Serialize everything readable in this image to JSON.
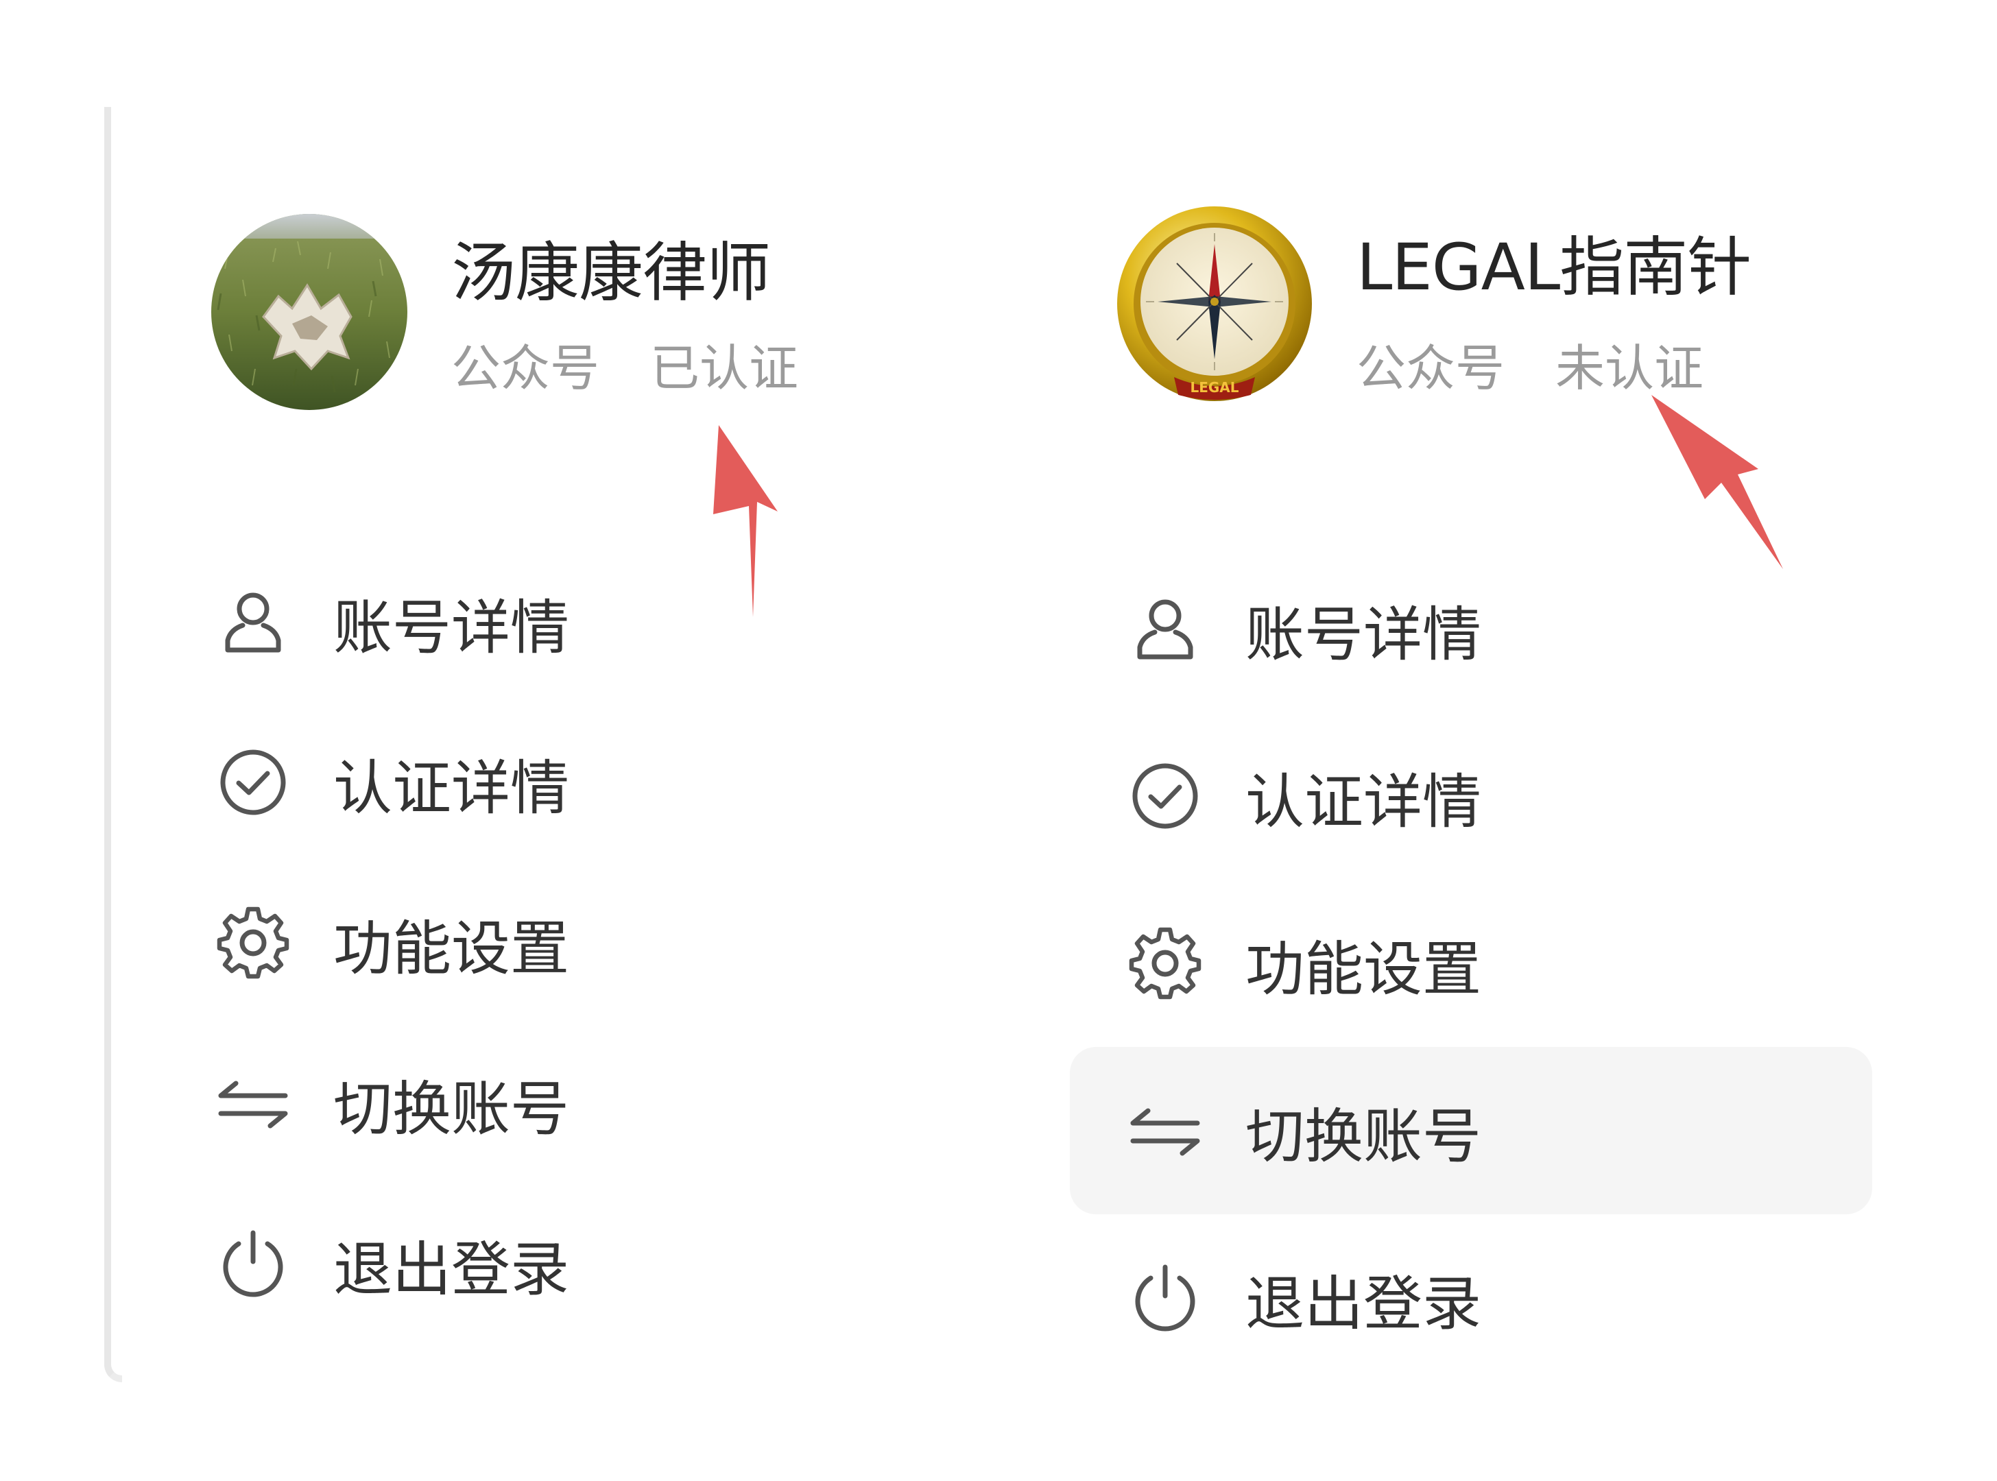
{
  "colors": {
    "text_primary": "#262626",
    "text_secondary": "#9b9b9b",
    "icon": "#555555",
    "hover_bg": "#f5f5f5",
    "annotation_arrow": "#e35c5a"
  },
  "accounts": [
    {
      "name": "汤康康律师",
      "type": "公众号",
      "status": "已认证",
      "avatar_icon": "grass-field-avatar",
      "menu": [
        {
          "label": "账号详情",
          "icon": "user-icon"
        },
        {
          "label": "认证详情",
          "icon": "check-circle-icon"
        },
        {
          "label": "功能设置",
          "icon": "gear-icon"
        },
        {
          "label": "切换账号",
          "icon": "switch-arrows-icon"
        },
        {
          "label": "退出登录",
          "icon": "power-icon"
        }
      ]
    },
    {
      "name": "LEGAL指南针",
      "type": "公众号",
      "status": "未认证",
      "avatar_icon": "compass-avatar",
      "avatar_text": "LEGAL",
      "menu": [
        {
          "label": "账号详情",
          "icon": "user-icon"
        },
        {
          "label": "认证详情",
          "icon": "check-circle-icon"
        },
        {
          "label": "功能设置",
          "icon": "gear-icon"
        },
        {
          "label": "切换账号",
          "icon": "switch-arrows-icon",
          "hovered": true
        },
        {
          "label": "退出登录",
          "icon": "power-icon"
        }
      ]
    }
  ]
}
